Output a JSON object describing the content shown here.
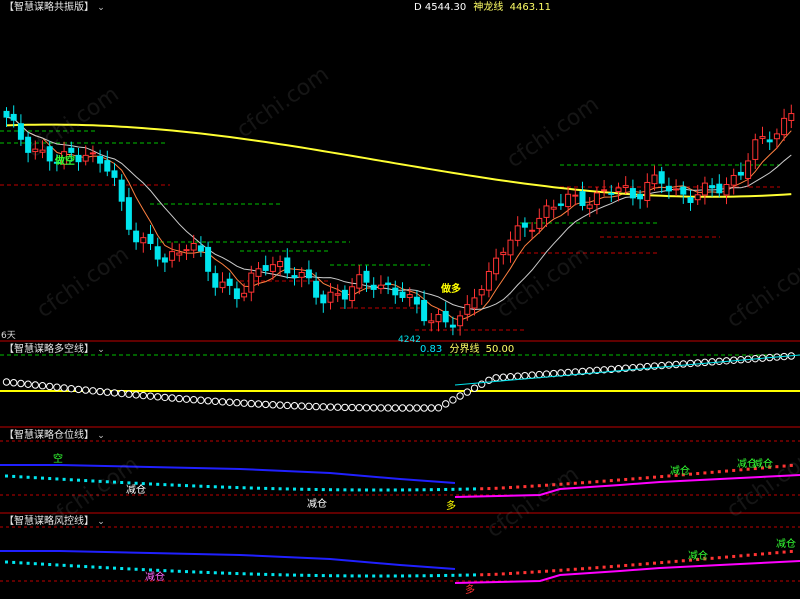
{
  "panes": {
    "main": {
      "title": "【智慧谋略共振版】",
      "caret": "⌄",
      "legend": [
        {
          "label": "D 4544.30",
          "color": "#ffffff"
        },
        {
          "label": "神龙线",
          "color": "#ffff66"
        },
        {
          "label": "4463.11",
          "color": "#ffff66"
        }
      ],
      "axis_corner": "6天",
      "low_label": "4242",
      "signals": [
        {
          "text": "做空",
          "color": "#33ff33"
        },
        {
          "text": "做多",
          "color": "#ffff00"
        }
      ]
    },
    "duokong": {
      "title": "【智慧谋略多空线】",
      "caret": "⌄",
      "legend": [
        {
          "label": "0.83",
          "color": "#00e5ff"
        },
        {
          "label": "分界线",
          "color": "#ffff66"
        },
        {
          "label": "50.00",
          "color": "#ffff66"
        }
      ]
    },
    "cangwei": {
      "title": "【智慧谋略仓位线】",
      "caret": "⌄",
      "marks": [
        {
          "text": "空",
          "color": "#33ff33"
        },
        {
          "text": "减仓",
          "color": "#ffffff"
        },
        {
          "text": "减仓",
          "color": "#ffffff"
        },
        {
          "text": "多",
          "color": "#ffff00"
        },
        {
          "text": "减仓",
          "color": "#33ff33"
        },
        {
          "text": "减仓",
          "color": "#33ff33"
        },
        {
          "text": "减仓",
          "color": "#33ff33"
        }
      ]
    },
    "fengkong": {
      "title": "【智慧谋略风控线】",
      "caret": "⌄",
      "marks": [
        {
          "text": "减仓",
          "color": "#ff66ff"
        },
        {
          "text": "多",
          "color": "#ff3333"
        },
        {
          "text": "减仓",
          "color": "#33ff33"
        },
        {
          "text": "减仓",
          "color": "#33ff33"
        }
      ]
    }
  },
  "watermark": "cfchi.com",
  "colors": {
    "up": "#ff3333",
    "down": "#00e5ee",
    "ma_yellow": "#ffff33",
    "ma_white": "#cccccc",
    "ma_orange": "#ff8040",
    "pane_border": "#c00000",
    "level_green": "#00c000",
    "level_red": "#c00000",
    "circle": "#ffffff",
    "divider_yellow": "#ffff00",
    "pos_blue": "#2020ff",
    "pos_magenta": "#ff00ff",
    "pos_cyan": "#00e5ee",
    "pos_red": "#ff3333"
  },
  "chart_data": {
    "type": "candlestick",
    "close_path": [
      4530,
      4510,
      4495,
      4480,
      4470,
      4485,
      4490,
      4470,
      4460,
      4400,
      4370,
      4350,
      4330,
      4345,
      4370,
      4330,
      4300,
      4300,
      4290,
      4310,
      4330,
      4330,
      4320,
      4300,
      4280,
      4290,
      4290,
      4300,
      4305,
      4300,
      4290,
      4270,
      4260,
      4255,
      4245,
      4250,
      4300,
      4320,
      4350,
      4370,
      4390,
      4400,
      4410,
      4420,
      4425,
      4420,
      4430,
      4435,
      4430,
      4440,
      4445,
      4430,
      4430,
      4428,
      4432,
      4440,
      4460,
      4490,
      4500,
      4520,
      4545
    ],
    "low_value": 4242,
    "last_close": 4544.3,
    "shenlong_line": 4463.11,
    "duokong_value": 0.83,
    "boundary_line": 50.0
  }
}
